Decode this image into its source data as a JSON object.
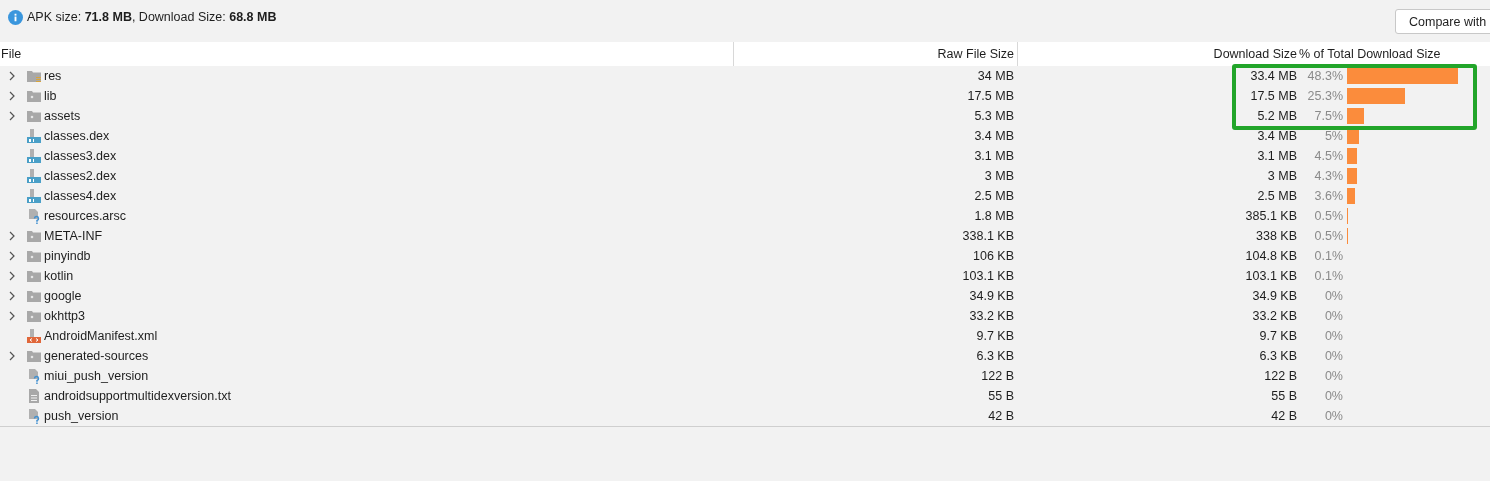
{
  "summary": "APK size: **71.8 MB**, Download Size: **68.8 MB**",
  "compare_button": "Compare with",
  "table": {
    "columns": [
      "File",
      "Raw File Size",
      "Download Size",
      "% of Total Download Size"
    ],
    "rows": [
      {
        "kind": "res-folder",
        "name": "res",
        "raw": "34 MB",
        "download": "33.4 MB",
        "percent": "48.3%"
      },
      {
        "kind": "folder",
        "name": "lib",
        "raw": "17.5 MB",
        "download": "17.5 MB",
        "percent": "25.3%"
      },
      {
        "kind": "folder",
        "name": "assets",
        "raw": "5.3 MB",
        "download": "5.2 MB",
        "percent": "7.5%"
      },
      {
        "kind": "dex",
        "name": "classes.dex",
        "raw": "3.4 MB",
        "download": "3.4 MB",
        "percent": "5%"
      },
      {
        "kind": "dex",
        "name": "classes3.dex",
        "raw": "3.1 MB",
        "download": "3.1 MB",
        "percent": "4.5%"
      },
      {
        "kind": "dex",
        "name": "classes2.dex",
        "raw": "3 MB",
        "download": "3 MB",
        "percent": "4.3%"
      },
      {
        "kind": "dex",
        "name": "classes4.dex",
        "raw": "2.5 MB",
        "download": "2.5 MB",
        "percent": "3.6%"
      },
      {
        "kind": "unknown",
        "name": "resources.arsc",
        "raw": "1.8 MB",
        "download": "385.1 KB",
        "percent": "0.5%"
      },
      {
        "kind": "folder",
        "name": "META-INF",
        "raw": "338.1 KB",
        "download": "338 KB",
        "percent": "0.5%"
      },
      {
        "kind": "folder",
        "name": "pinyindb",
        "raw": "106 KB",
        "download": "104.8 KB",
        "percent": "0.1%"
      },
      {
        "kind": "folder",
        "name": "kotlin",
        "raw": "103.1 KB",
        "download": "103.1 KB",
        "percent": "0.1%"
      },
      {
        "kind": "folder",
        "name": "google",
        "raw": "34.9 KB",
        "download": "34.9 KB",
        "percent": "0%"
      },
      {
        "kind": "folder",
        "name": "okhttp3",
        "raw": "33.2 KB",
        "download": "33.2 KB",
        "percent": "0%"
      },
      {
        "kind": "xml",
        "name": "AndroidManifest.xml",
        "raw": "9.7 KB",
        "download": "9.7 KB",
        "percent": "0%"
      },
      {
        "kind": "folder",
        "name": "generated-sources",
        "raw": "6.3 KB",
        "download": "6.3 KB",
        "percent": "0%"
      },
      {
        "kind": "unknown",
        "name": "miui_push_version",
        "raw": "122 B",
        "download": "122 B",
        "percent": "0%"
      },
      {
        "kind": "text",
        "name": "androidsupportmultidexversion.txt",
        "raw": "55 B",
        "download": "55 B",
        "percent": "0%"
      },
      {
        "kind": "unknown",
        "name": "push_version",
        "raw": "42 B",
        "download": "42 B",
        "percent": "0%"
      }
    ]
  }
}
